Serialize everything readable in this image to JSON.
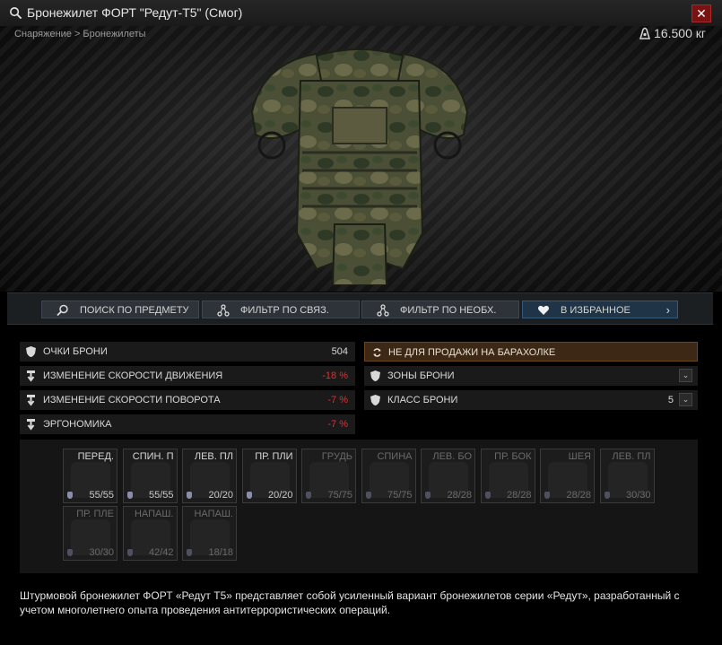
{
  "window": {
    "title": "Бронежилет ФОРТ \"Редут-Т5\" (Смог)"
  },
  "breadcrumb": "Снаряжение > Бронежилеты",
  "weight": "16.500 кг",
  "actions": {
    "search": "ПОИСК ПО ПРЕДМЕТУ",
    "filter_linked": "ФИЛЬТР ПО СВЯЗ.",
    "filter_required": "ФИЛЬТР ПО НЕОБХ.",
    "favorite": "В ИЗБРАННОЕ"
  },
  "stats_left": [
    {
      "label": "Очки брони",
      "value": "504",
      "icon": "shield-icon",
      "negative": false
    },
    {
      "label": "Изменение скорости движения",
      "value": "-18 %",
      "icon": "speed-icon",
      "negative": true
    },
    {
      "label": "Изменение скорости поворота",
      "value": "-7 %",
      "icon": "turn-icon",
      "negative": true
    },
    {
      "label": "Эргономика",
      "value": "-7 %",
      "icon": "ergonomics-icon",
      "negative": true
    }
  ],
  "stats_right": {
    "not_for_sale": "НЕ ДЛЯ ПРОДАЖИ НА БАРАХОЛКЕ",
    "armor_zones": "ЗОНЫ БРОНИ",
    "armor_class_label": "КЛАСС БРОНИ",
    "armor_class_value": "5"
  },
  "zones": [
    {
      "name": "ПЕРЕД.",
      "dur": "55/55",
      "dim": false
    },
    {
      "name": "СПИН. П",
      "dur": "55/55",
      "dim": false
    },
    {
      "name": "ЛЕВ. ПЛ",
      "dur": "20/20",
      "dim": false
    },
    {
      "name": "ПР. ПЛИ",
      "dur": "20/20",
      "dim": false
    },
    {
      "name": "ГРУДЬ",
      "dur": "75/75",
      "dim": true
    },
    {
      "name": "СПИНА",
      "dur": "75/75",
      "dim": true
    },
    {
      "name": "ЛЕВ. БО",
      "dur": "28/28",
      "dim": true
    },
    {
      "name": "ПР. БОК",
      "dur": "28/28",
      "dim": true
    },
    {
      "name": "ШЕЯ",
      "dur": "28/28",
      "dim": true
    },
    {
      "name": "ЛЕВ. ПЛ",
      "dur": "30/30",
      "dim": true
    },
    {
      "name": "ПР. ПЛЕ",
      "dur": "30/30",
      "dim": true
    },
    {
      "name": "НАПАШ.",
      "dur": "42/42",
      "dim": true
    },
    {
      "name": "НАПАШ.",
      "dur": "18/18",
      "dim": true
    }
  ],
  "description": "Штурмовой бронежилет ФОРТ «Редут Т5» представляет собой усиленный вариант бронежилетов серии «Редут», разработанный с учетом многолетнего опыта проведения антитеррористических операций.",
  "colors": {
    "accent_fav": "#1f3446",
    "negative": "#e03030",
    "not_for_sale_bg": "#3c2815",
    "close": "#7a1212"
  }
}
